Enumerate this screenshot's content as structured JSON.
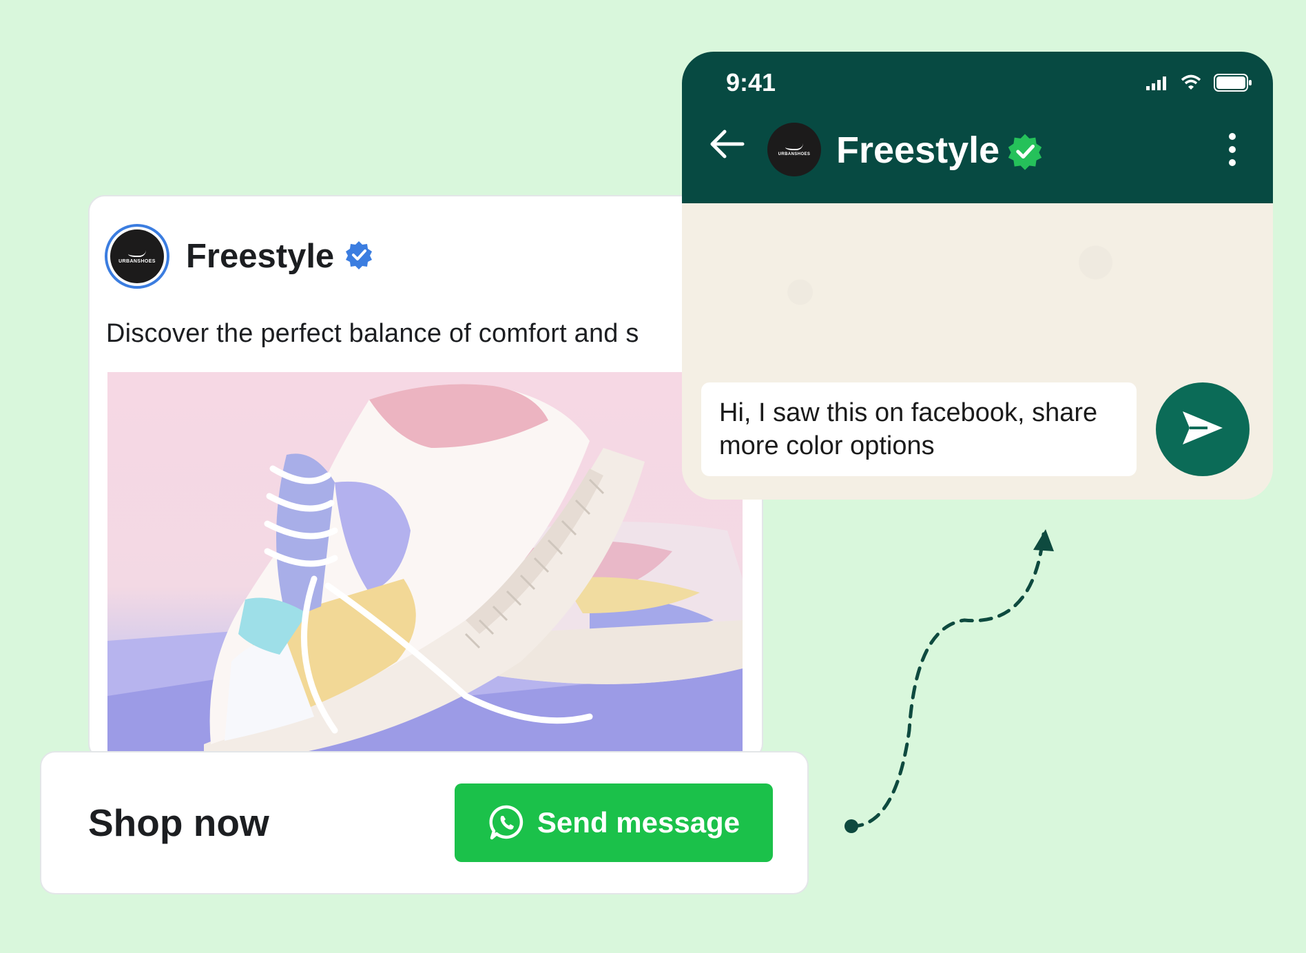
{
  "colors": {
    "page_background": "#d9f7dc",
    "whatsapp_header": "#074a42",
    "whatsapp_send": "#0b6b57",
    "cta_green": "#1bc14a",
    "facebook_verified": "#3b7de0",
    "whatsapp_verified": "#25c15a"
  },
  "ad": {
    "brand_name": "Freestyle",
    "avatar_text": "URBANSHOES",
    "caption": "Discover the perfect balance of comfort and s",
    "image_icon": "pastel-sneaker-photo",
    "verified_icon": "blue-verified-badge-icon"
  },
  "cta": {
    "label": "Shop now",
    "button_label": "Send message",
    "button_icon": "whatsapp-icon"
  },
  "chat": {
    "status_time": "9:41",
    "status_icons": [
      "signal-icon",
      "wifi-icon",
      "battery-icon"
    ],
    "back_icon": "back-arrow-icon",
    "contact_name": "Freestyle",
    "avatar_text": "URBANSHOES",
    "verified_icon": "green-verified-badge-icon",
    "menu_icon": "more-vertical-icon",
    "draft_message": "Hi, I saw this on facebook, share more color options",
    "send_icon": "send-icon"
  }
}
